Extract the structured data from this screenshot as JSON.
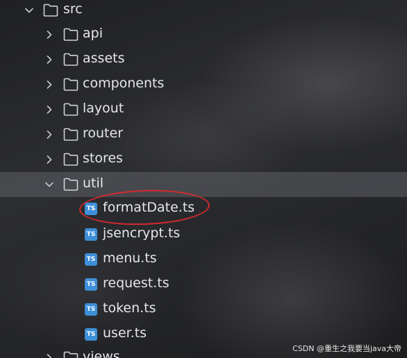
{
  "tree": {
    "root": {
      "label": "src",
      "expanded": true,
      "icon": "folder-icon"
    },
    "folders": [
      {
        "label": "api",
        "expanded": false
      },
      {
        "label": "assets",
        "expanded": false
      },
      {
        "label": "components",
        "expanded": false
      },
      {
        "label": "layout",
        "expanded": false
      },
      {
        "label": "router",
        "expanded": false
      },
      {
        "label": "stores",
        "expanded": false
      },
      {
        "label": "util",
        "expanded": true
      }
    ],
    "util_files": [
      {
        "label": "formatDate.ts",
        "icon": "TS"
      },
      {
        "label": "jsencrypt.ts",
        "icon": "TS"
      },
      {
        "label": "menu.ts",
        "icon": "TS"
      },
      {
        "label": "request.ts",
        "icon": "TS"
      },
      {
        "label": "token.ts",
        "icon": "TS"
      },
      {
        "label": "user.ts",
        "icon": "TS"
      }
    ],
    "next_folder": {
      "label": "views",
      "expanded": false
    }
  },
  "annotation": {
    "highlighted_file": "formatDate.ts",
    "color": "#d42a2f"
  },
  "ts_icon_text": "TS",
  "colors": {
    "ts_icon": "#3d8fd8",
    "selected_row": "#5f6166",
    "text": "#e6e7ea"
  },
  "watermark": "CSDN @重生之我要当java大帝"
}
